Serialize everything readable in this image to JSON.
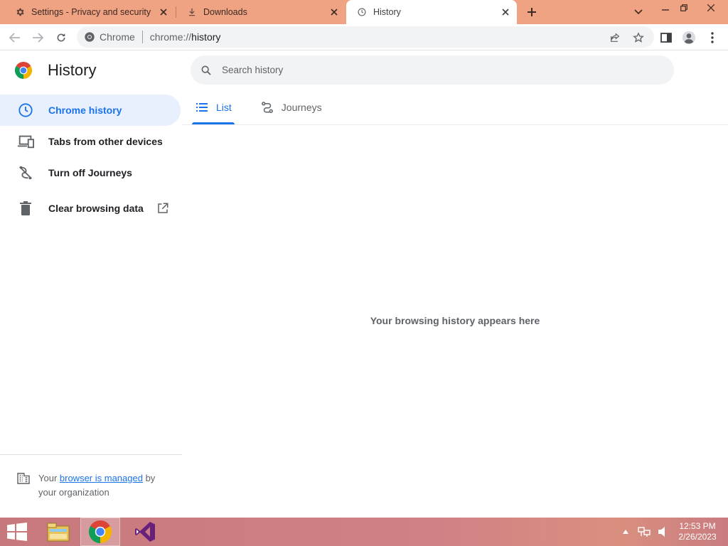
{
  "browser": {
    "tabs": [
      {
        "title": "Settings - Privacy and security",
        "icon": "gear-icon"
      },
      {
        "title": "Downloads",
        "icon": "download-icon"
      },
      {
        "title": "History",
        "icon": "history-icon",
        "active": true
      }
    ],
    "omnibox": {
      "site_label": "Chrome",
      "url_scheme": "chrome://",
      "url_host": "history"
    }
  },
  "page": {
    "title": "History",
    "search": {
      "placeholder": "Search history",
      "value": ""
    },
    "sidebar": {
      "items": [
        {
          "label": "Chrome history",
          "icon": "clock-icon",
          "active": true
        },
        {
          "label": "Tabs from other devices",
          "icon": "devices-icon"
        },
        {
          "label": "Turn off Journeys",
          "icon": "journeys-off-icon"
        },
        {
          "label": "Clear browsing data",
          "icon": "trash-icon",
          "trailing_icon": "open-in-new-icon"
        }
      ],
      "managed": {
        "prefix": "Your ",
        "link": "browser is managed",
        "suffix": " by your organization"
      }
    },
    "tabs": [
      {
        "label": "List",
        "icon": "list-icon",
        "active": true
      },
      {
        "label": "Journeys",
        "icon": "journeys-icon"
      }
    ],
    "empty_message": "Your browsing history appears here"
  },
  "taskbar": {
    "apps": [
      "file-explorer-icon",
      "chrome-icon",
      "visual-studio-icon"
    ],
    "time": "12:53 PM",
    "date": "2/26/2023"
  },
  "colors": {
    "accent": "#1a73e8",
    "tabstrip": "#f0a383",
    "active_nav": "#e8f0fe"
  }
}
